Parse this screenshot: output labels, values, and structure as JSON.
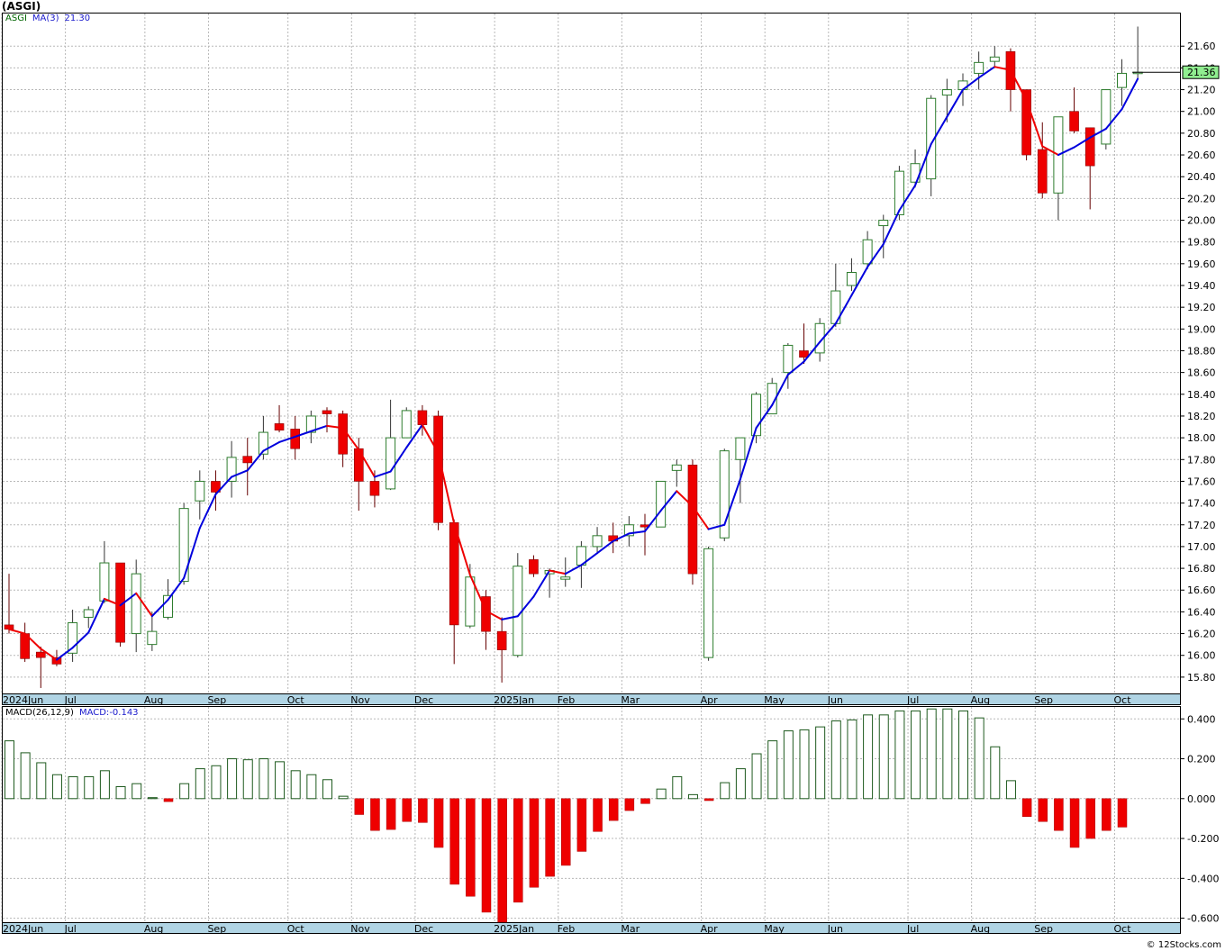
{
  "title": "(ASGI)",
  "copyright": "© 12Stocks.com",
  "colors": {
    "up_candle": "#2e7d2e",
    "down_candle": "#ee0000",
    "ma_up": "#0000dd",
    "ma_down": "#ee0000",
    "macd_pos_stroke": "#1e5a1e",
    "macd_neg_fill": "#ee0000",
    "axis_band": "#b0d4e4",
    "last_price_box": "#90ee90"
  },
  "price_legend": {
    "symbol": "ASGI",
    "indicator": "MA(3)",
    "value": "21.30"
  },
  "macd_legend": {
    "indicator": "MACD(26,12,9)",
    "label": "MACD:",
    "value": "-0.143"
  },
  "last_price_label": "21.36",
  "chart_data": [
    {
      "type": "candlestick",
      "y_range": [
        15.65,
        21.9
      ],
      "y_ticks": [
        15.8,
        16.0,
        16.2,
        16.4,
        16.6,
        16.8,
        17.0,
        17.2,
        17.4,
        17.6,
        17.8,
        18.0,
        18.2,
        18.4,
        18.6,
        18.8,
        19.0,
        19.2,
        19.4,
        19.6,
        19.8,
        20.0,
        20.2,
        20.4,
        20.6,
        20.8,
        21.0,
        21.2,
        21.4,
        21.6
      ],
      "x_labels": [
        {
          "label": "2024Jun",
          "index": 0
        },
        {
          "label": "Jul",
          "index": 4
        },
        {
          "label": "Aug",
          "index": 9
        },
        {
          "label": "Sep",
          "index": 13
        },
        {
          "label": "Oct",
          "index": 18
        },
        {
          "label": "Nov",
          "index": 22
        },
        {
          "label": "Dec",
          "index": 26
        },
        {
          "label": "2025Jan",
          "index": 31
        },
        {
          "label": "Feb",
          "index": 35
        },
        {
          "label": "Mar",
          "index": 39
        },
        {
          "label": "Apr",
          "index": 44
        },
        {
          "label": "May",
          "index": 48
        },
        {
          "label": "Jun",
          "index": 52
        },
        {
          "label": "Jul",
          "index": 57
        },
        {
          "label": "Aug",
          "index": 61
        },
        {
          "label": "Sep",
          "index": 65
        },
        {
          "label": "Oct",
          "index": 70
        }
      ],
      "ohlc": [
        [
          16.28,
          16.75,
          16.2,
          16.24
        ],
        [
          16.2,
          16.3,
          15.94,
          15.97
        ],
        [
          16.03,
          16.08,
          15.7,
          15.98
        ],
        [
          15.98,
          16.05,
          15.9,
          15.92
        ],
        [
          16.02,
          16.42,
          15.94,
          16.3
        ],
        [
          16.35,
          16.45,
          16.25,
          16.42
        ],
        [
          16.5,
          17.05,
          16.48,
          16.85
        ],
        [
          16.85,
          16.85,
          16.08,
          16.12
        ],
        [
          16.2,
          16.88,
          16.03,
          16.75
        ],
        [
          16.1,
          16.4,
          16.04,
          16.22
        ],
        [
          16.35,
          16.7,
          16.33,
          16.55
        ],
        [
          16.68,
          17.4,
          16.65,
          17.35
        ],
        [
          17.42,
          17.7,
          17.25,
          17.6
        ],
        [
          17.6,
          17.7,
          17.33,
          17.5
        ],
        [
          17.6,
          17.97,
          17.45,
          17.82
        ],
        [
          17.83,
          18.0,
          17.47,
          17.77
        ],
        [
          17.85,
          18.2,
          17.8,
          18.05
        ],
        [
          18.13,
          18.3,
          18.05,
          18.07
        ],
        [
          18.08,
          18.2,
          17.8,
          17.9
        ],
        [
          18.05,
          18.25,
          17.95,
          18.2
        ],
        [
          18.25,
          18.28,
          18.05,
          18.22
        ],
        [
          18.22,
          18.25,
          17.73,
          17.85
        ],
        [
          17.9,
          18.0,
          17.33,
          17.6
        ],
        [
          17.6,
          17.7,
          17.36,
          17.47
        ],
        [
          17.53,
          18.35,
          17.52,
          18.0
        ],
        [
          18.0,
          18.28,
          18.0,
          18.25
        ],
        [
          18.25,
          18.3,
          18.02,
          18.12
        ],
        [
          18.2,
          18.25,
          17.15,
          17.22
        ],
        [
          17.22,
          17.25,
          15.92,
          16.28
        ],
        [
          16.27,
          16.84,
          16.25,
          16.72
        ],
        [
          16.54,
          16.6,
          16.05,
          16.22
        ],
        [
          16.22,
          16.35,
          15.75,
          16.05
        ],
        [
          16.0,
          16.94,
          15.98,
          16.82
        ],
        [
          16.88,
          16.92,
          16.72,
          16.75
        ],
        [
          16.75,
          16.8,
          16.53,
          16.78
        ],
        [
          16.7,
          16.9,
          16.63,
          16.72
        ],
        [
          16.83,
          17.05,
          16.62,
          17.0
        ],
        [
          17.0,
          17.18,
          16.95,
          17.1
        ],
        [
          17.1,
          17.22,
          16.94,
          17.05
        ],
        [
          17.1,
          17.28,
          17.0,
          17.2
        ],
        [
          17.2,
          17.3,
          16.92,
          17.18
        ],
        [
          17.18,
          17.6,
          17.18,
          17.6
        ],
        [
          17.7,
          17.8,
          17.55,
          17.75
        ],
        [
          17.75,
          17.8,
          16.65,
          16.75
        ],
        [
          15.98,
          17.0,
          15.95,
          16.98
        ],
        [
          17.08,
          17.9,
          17.05,
          17.88
        ],
        [
          17.8,
          18.0,
          17.4,
          18.0
        ],
        [
          18.02,
          18.42,
          17.95,
          18.4
        ],
        [
          18.22,
          18.55,
          18.3,
          18.5
        ],
        [
          18.6,
          18.87,
          18.45,
          18.85
        ],
        [
          18.8,
          19.05,
          18.68,
          18.74
        ],
        [
          18.78,
          19.1,
          18.7,
          19.05
        ],
        [
          19.05,
          19.6,
          19.02,
          19.35
        ],
        [
          19.4,
          19.65,
          19.35,
          19.52
        ],
        [
          19.6,
          19.9,
          19.55,
          19.82
        ],
        [
          19.95,
          20.05,
          19.65,
          20.0
        ],
        [
          20.05,
          20.5,
          20.0,
          20.45
        ],
        [
          20.35,
          20.65,
          20.3,
          20.52
        ],
        [
          20.38,
          21.15,
          20.22,
          21.12
        ],
        [
          21.15,
          21.3,
          20.9,
          21.2
        ],
        [
          21.2,
          21.35,
          21.05,
          21.28
        ],
        [
          21.35,
          21.55,
          21.2,
          21.45
        ],
        [
          21.46,
          21.6,
          21.4,
          21.5
        ],
        [
          21.55,
          21.58,
          21.0,
          21.2
        ],
        [
          21.2,
          21.2,
          20.55,
          20.6
        ],
        [
          20.65,
          20.9,
          20.2,
          20.25
        ],
        [
          20.25,
          20.95,
          20.0,
          20.95
        ],
        [
          21.0,
          21.22,
          20.8,
          20.82
        ],
        [
          20.85,
          20.85,
          20.1,
          20.5
        ],
        [
          20.7,
          21.2,
          20.65,
          21.2
        ],
        [
          21.22,
          21.48,
          21.05,
          21.35
        ],
        [
          21.35,
          21.78,
          21.3,
          21.36
        ]
      ],
      "ma3": [
        16.24,
        16.2,
        16.06,
        15.96,
        16.07,
        16.21,
        16.52,
        16.46,
        16.57,
        16.36,
        16.51,
        16.71,
        17.17,
        17.48,
        17.64,
        17.7,
        17.88,
        17.96,
        18.01,
        18.06,
        18.11,
        18.09,
        17.89,
        17.64,
        17.69,
        17.91,
        18.12,
        17.86,
        17.21,
        16.74,
        16.41,
        16.33,
        16.36,
        16.54,
        16.78,
        16.75,
        16.83,
        16.94,
        17.05,
        17.12,
        17.14,
        17.33,
        17.51,
        17.37,
        17.16,
        17.2,
        17.62,
        18.09,
        18.3,
        18.58,
        18.7,
        18.88,
        19.05,
        19.31,
        19.57,
        19.78,
        20.09,
        20.32,
        20.7,
        20.95,
        21.2,
        21.31,
        21.41,
        21.38,
        21.1,
        20.68,
        20.6,
        20.67,
        20.76,
        20.84,
        21.02,
        21.3
      ]
    },
    {
      "type": "bar",
      "y_range": [
        -0.62,
        0.46
      ],
      "y_ticks": [
        0.4,
        0.2,
        0.0,
        -0.2,
        -0.4,
        -0.6
      ],
      "values": [
        0.29,
        0.23,
        0.18,
        0.12,
        0.11,
        0.11,
        0.14,
        0.06,
        0.075,
        0.005,
        -0.015,
        0.075,
        0.15,
        0.165,
        0.2,
        0.195,
        0.2,
        0.185,
        0.14,
        0.12,
        0.095,
        0.012,
        -0.08,
        -0.16,
        -0.155,
        -0.115,
        -0.12,
        -0.245,
        -0.43,
        -0.49,
        -0.57,
        -0.62,
        -0.52,
        -0.445,
        -0.39,
        -0.335,
        -0.265,
        -0.165,
        -0.11,
        -0.06,
        -0.025,
        0.048,
        0.11,
        0.02,
        -0.01,
        0.08,
        0.15,
        0.225,
        0.29,
        0.34,
        0.345,
        0.36,
        0.39,
        0.395,
        0.42,
        0.42,
        0.44,
        0.44,
        0.45,
        0.45,
        0.44,
        0.405,
        0.26,
        0.09,
        -0.09,
        -0.115,
        -0.16,
        -0.245,
        -0.2,
        -0.16,
        -0.143
      ]
    }
  ]
}
